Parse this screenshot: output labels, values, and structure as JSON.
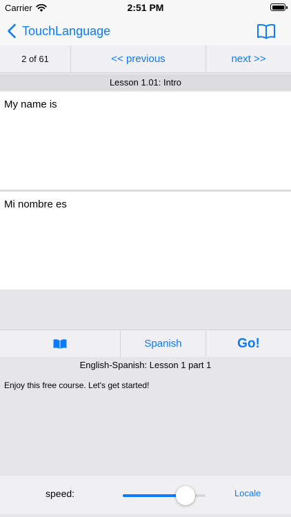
{
  "status_bar": {
    "carrier": "Carrier",
    "time": "2:51 PM"
  },
  "nav": {
    "back_label": "TouchLanguage",
    "right_icon": "book-icon"
  },
  "pager": {
    "counter": "2 of 61",
    "previous_label": "<< previous",
    "next_label": "next >>"
  },
  "lesson": {
    "title": "Lesson 1.01: Intro"
  },
  "phrases": {
    "source": "My name is",
    "translation": "Mi nombre es"
  },
  "actions": {
    "library_icon": "book-filled-icon",
    "language_label": "Spanish",
    "go_label": "Go!"
  },
  "course": {
    "title": "English-Spanish: Lesson 1 part 1",
    "description": "Enjoy this free course. Let's get started!"
  },
  "controls": {
    "speed_label": "speed:",
    "speed_value": 0.76,
    "locale_label": "Locale"
  },
  "colors": {
    "accent": "#0a7aff",
    "background": "#e5e5ea",
    "bar": "#f0f0f3"
  }
}
